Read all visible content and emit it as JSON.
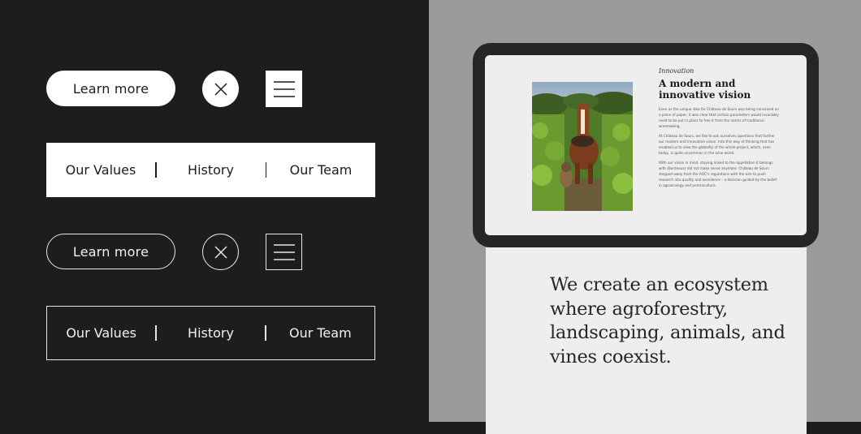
{
  "buttons": {
    "learn_more_filled": "Learn more",
    "learn_more_outline": "Learn more"
  },
  "nav_filled": [
    "Our Values",
    "History",
    "Our Team"
  ],
  "nav_outline": [
    "Our Values",
    "History",
    "Our Team"
  ],
  "icons": {
    "close": "close-icon",
    "menu": "hamburger-menu-icon"
  },
  "tablet": {
    "eyebrow": "Innovation",
    "heading": "A modern and innovative vision",
    "paragraphs": [
      "Even as the unique idea for Château de Sours was being conceived on a piece of paper, it was clear that certain parameters would invariably need to be put in place to free it from the norms of traditional winemaking.",
      "At Château de Sours, we like to ask ourselves questions that further our modern and innovative vision. Into this way of thinking that has enabled us to view the globality of the whole project, which, even today, is quite uncommon in the wine world.",
      "With our vision in mind, staying linked to the appellation it belongs with (Bordeaux) did not make sense anymore. Château de Sours stepped away from the AOC's regulations with the aim to push research into quality and excellence – a decision guided by the belief in agroecology and permaculture."
    ]
  },
  "card": {
    "quote": "We create an ecosystem where agroforestry, landscaping, animals, and vines coexist."
  },
  "colors": {
    "dark_bg": "#1d1d1d",
    "gray_bg": "#9b9b9b",
    "light_surface": "#eeeeee",
    "white": "#ffffff"
  }
}
